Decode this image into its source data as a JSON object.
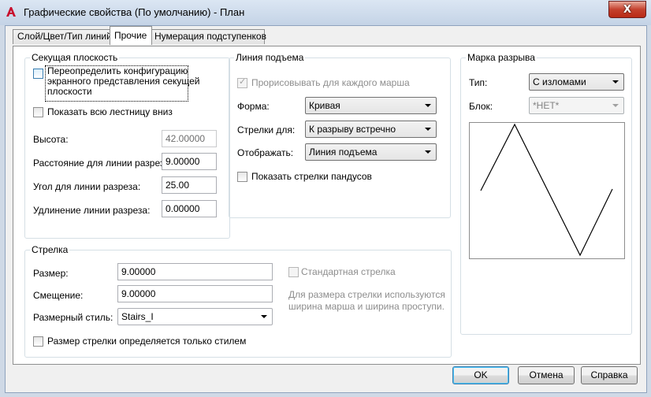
{
  "window": {
    "title": "Графические свойства (По умолчанию) - План",
    "close_glyph": "X",
    "accent_color": "#cfd9e6"
  },
  "tabs": [
    {
      "label": "Слой/Цвет/Тип линий",
      "active": false
    },
    {
      "label": "Прочие",
      "active": true
    },
    {
      "label": "Нумерация подступенков",
      "active": false
    }
  ],
  "section_cut": {
    "title": "Секущая плоскость",
    "override_checkbox": {
      "label_line1": "Переопределить конфигурацию",
      "label_line2": "экранного представления секущей",
      "label_line3": "плоскости",
      "checked": false
    },
    "show_all_stair_checkbox": {
      "label": "Показать всю лестницу вниз",
      "checked": false
    },
    "height": {
      "label": "Высота:",
      "value": "42.00000",
      "disabled": true
    },
    "cut_line_distance": {
      "label": "Расстояние для линии разреза:",
      "value": "9.00000"
    },
    "cut_line_angle": {
      "label": "Угол для линии разреза:",
      "value": "25.00"
    },
    "cut_line_extension": {
      "label": "Удлинение линии разреза:",
      "value": "0.00000"
    }
  },
  "rise_line": {
    "title": "Линия подъема",
    "draw_each_flight_checkbox": {
      "label": "Прорисовывать для каждого марша",
      "checked": true,
      "disabled": true
    },
    "shape": {
      "label": "Форма:",
      "value": "Кривая"
    },
    "arrows_for": {
      "label": "Стрелки для:",
      "value": "К разрыву встречно"
    },
    "display": {
      "label": "Отображать:",
      "value": "Линия подъема"
    },
    "show_ramp_arrows_checkbox": {
      "label": "Показать стрелки пандусов",
      "checked": false
    }
  },
  "break_mark": {
    "title": "Марка разрыва",
    "type": {
      "label": "Тип:",
      "value": "С изломами"
    },
    "block": {
      "label": "Блок:",
      "value": "*НЕТ*",
      "disabled": true
    }
  },
  "arrow": {
    "title": "Стрелка",
    "size": {
      "label": "Размер:",
      "value": "9.00000"
    },
    "offset": {
      "label": "Смещение:",
      "value": "9.00000"
    },
    "dim_style": {
      "label": "Размерный стиль:",
      "value": "Stairs_I"
    },
    "standard_arrow_checkbox": {
      "label": "Стандартная стрелка",
      "checked": false,
      "disabled": true
    },
    "note_line1": "Для размера стрелки используются",
    "note_line2": "ширина марша и ширина проступи.",
    "size_by_style_checkbox": {
      "label": "Размер стрелки определяется только стилем",
      "checked": false
    }
  },
  "buttons": {
    "ok": "OK",
    "cancel": "Отмена",
    "help": "Справка"
  }
}
